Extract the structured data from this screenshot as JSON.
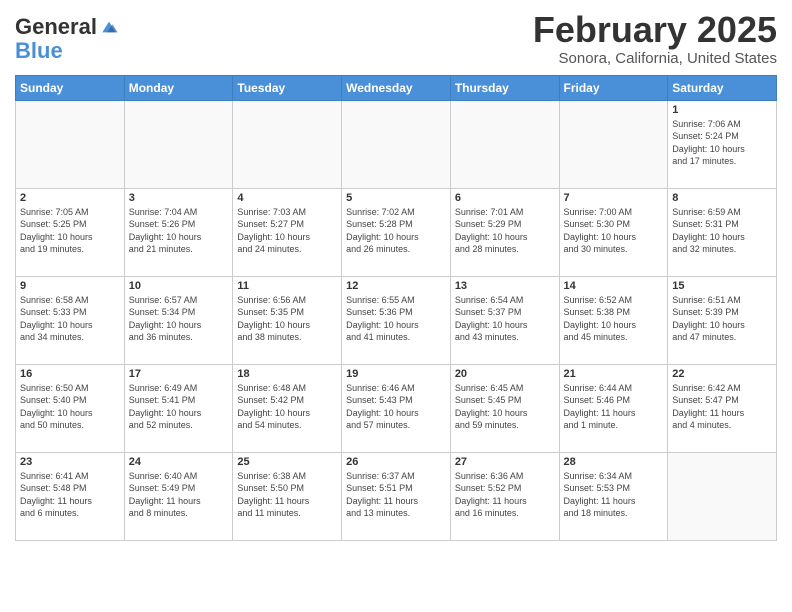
{
  "header": {
    "logo_line1": "General",
    "logo_line2": "Blue",
    "title": "February 2025",
    "subtitle": "Sonora, California, United States"
  },
  "days_of_week": [
    "Sunday",
    "Monday",
    "Tuesday",
    "Wednesday",
    "Thursday",
    "Friday",
    "Saturday"
  ],
  "weeks": [
    [
      {
        "num": "",
        "detail": ""
      },
      {
        "num": "",
        "detail": ""
      },
      {
        "num": "",
        "detail": ""
      },
      {
        "num": "",
        "detail": ""
      },
      {
        "num": "",
        "detail": ""
      },
      {
        "num": "",
        "detail": ""
      },
      {
        "num": "1",
        "detail": "Sunrise: 7:06 AM\nSunset: 5:24 PM\nDaylight: 10 hours\nand 17 minutes."
      }
    ],
    [
      {
        "num": "2",
        "detail": "Sunrise: 7:05 AM\nSunset: 5:25 PM\nDaylight: 10 hours\nand 19 minutes."
      },
      {
        "num": "3",
        "detail": "Sunrise: 7:04 AM\nSunset: 5:26 PM\nDaylight: 10 hours\nand 21 minutes."
      },
      {
        "num": "4",
        "detail": "Sunrise: 7:03 AM\nSunset: 5:27 PM\nDaylight: 10 hours\nand 24 minutes."
      },
      {
        "num": "5",
        "detail": "Sunrise: 7:02 AM\nSunset: 5:28 PM\nDaylight: 10 hours\nand 26 minutes."
      },
      {
        "num": "6",
        "detail": "Sunrise: 7:01 AM\nSunset: 5:29 PM\nDaylight: 10 hours\nand 28 minutes."
      },
      {
        "num": "7",
        "detail": "Sunrise: 7:00 AM\nSunset: 5:30 PM\nDaylight: 10 hours\nand 30 minutes."
      },
      {
        "num": "8",
        "detail": "Sunrise: 6:59 AM\nSunset: 5:31 PM\nDaylight: 10 hours\nand 32 minutes."
      }
    ],
    [
      {
        "num": "9",
        "detail": "Sunrise: 6:58 AM\nSunset: 5:33 PM\nDaylight: 10 hours\nand 34 minutes."
      },
      {
        "num": "10",
        "detail": "Sunrise: 6:57 AM\nSunset: 5:34 PM\nDaylight: 10 hours\nand 36 minutes."
      },
      {
        "num": "11",
        "detail": "Sunrise: 6:56 AM\nSunset: 5:35 PM\nDaylight: 10 hours\nand 38 minutes."
      },
      {
        "num": "12",
        "detail": "Sunrise: 6:55 AM\nSunset: 5:36 PM\nDaylight: 10 hours\nand 41 minutes."
      },
      {
        "num": "13",
        "detail": "Sunrise: 6:54 AM\nSunset: 5:37 PM\nDaylight: 10 hours\nand 43 minutes."
      },
      {
        "num": "14",
        "detail": "Sunrise: 6:52 AM\nSunset: 5:38 PM\nDaylight: 10 hours\nand 45 minutes."
      },
      {
        "num": "15",
        "detail": "Sunrise: 6:51 AM\nSunset: 5:39 PM\nDaylight: 10 hours\nand 47 minutes."
      }
    ],
    [
      {
        "num": "16",
        "detail": "Sunrise: 6:50 AM\nSunset: 5:40 PM\nDaylight: 10 hours\nand 50 minutes."
      },
      {
        "num": "17",
        "detail": "Sunrise: 6:49 AM\nSunset: 5:41 PM\nDaylight: 10 hours\nand 52 minutes."
      },
      {
        "num": "18",
        "detail": "Sunrise: 6:48 AM\nSunset: 5:42 PM\nDaylight: 10 hours\nand 54 minutes."
      },
      {
        "num": "19",
        "detail": "Sunrise: 6:46 AM\nSunset: 5:43 PM\nDaylight: 10 hours\nand 57 minutes."
      },
      {
        "num": "20",
        "detail": "Sunrise: 6:45 AM\nSunset: 5:45 PM\nDaylight: 10 hours\nand 59 minutes."
      },
      {
        "num": "21",
        "detail": "Sunrise: 6:44 AM\nSunset: 5:46 PM\nDaylight: 11 hours\nand 1 minute."
      },
      {
        "num": "22",
        "detail": "Sunrise: 6:42 AM\nSunset: 5:47 PM\nDaylight: 11 hours\nand 4 minutes."
      }
    ],
    [
      {
        "num": "23",
        "detail": "Sunrise: 6:41 AM\nSunset: 5:48 PM\nDaylight: 11 hours\nand 6 minutes."
      },
      {
        "num": "24",
        "detail": "Sunrise: 6:40 AM\nSunset: 5:49 PM\nDaylight: 11 hours\nand 8 minutes."
      },
      {
        "num": "25",
        "detail": "Sunrise: 6:38 AM\nSunset: 5:50 PM\nDaylight: 11 hours\nand 11 minutes."
      },
      {
        "num": "26",
        "detail": "Sunrise: 6:37 AM\nSunset: 5:51 PM\nDaylight: 11 hours\nand 13 minutes."
      },
      {
        "num": "27",
        "detail": "Sunrise: 6:36 AM\nSunset: 5:52 PM\nDaylight: 11 hours\nand 16 minutes."
      },
      {
        "num": "28",
        "detail": "Sunrise: 6:34 AM\nSunset: 5:53 PM\nDaylight: 11 hours\nand 18 minutes."
      },
      {
        "num": "",
        "detail": ""
      }
    ]
  ]
}
